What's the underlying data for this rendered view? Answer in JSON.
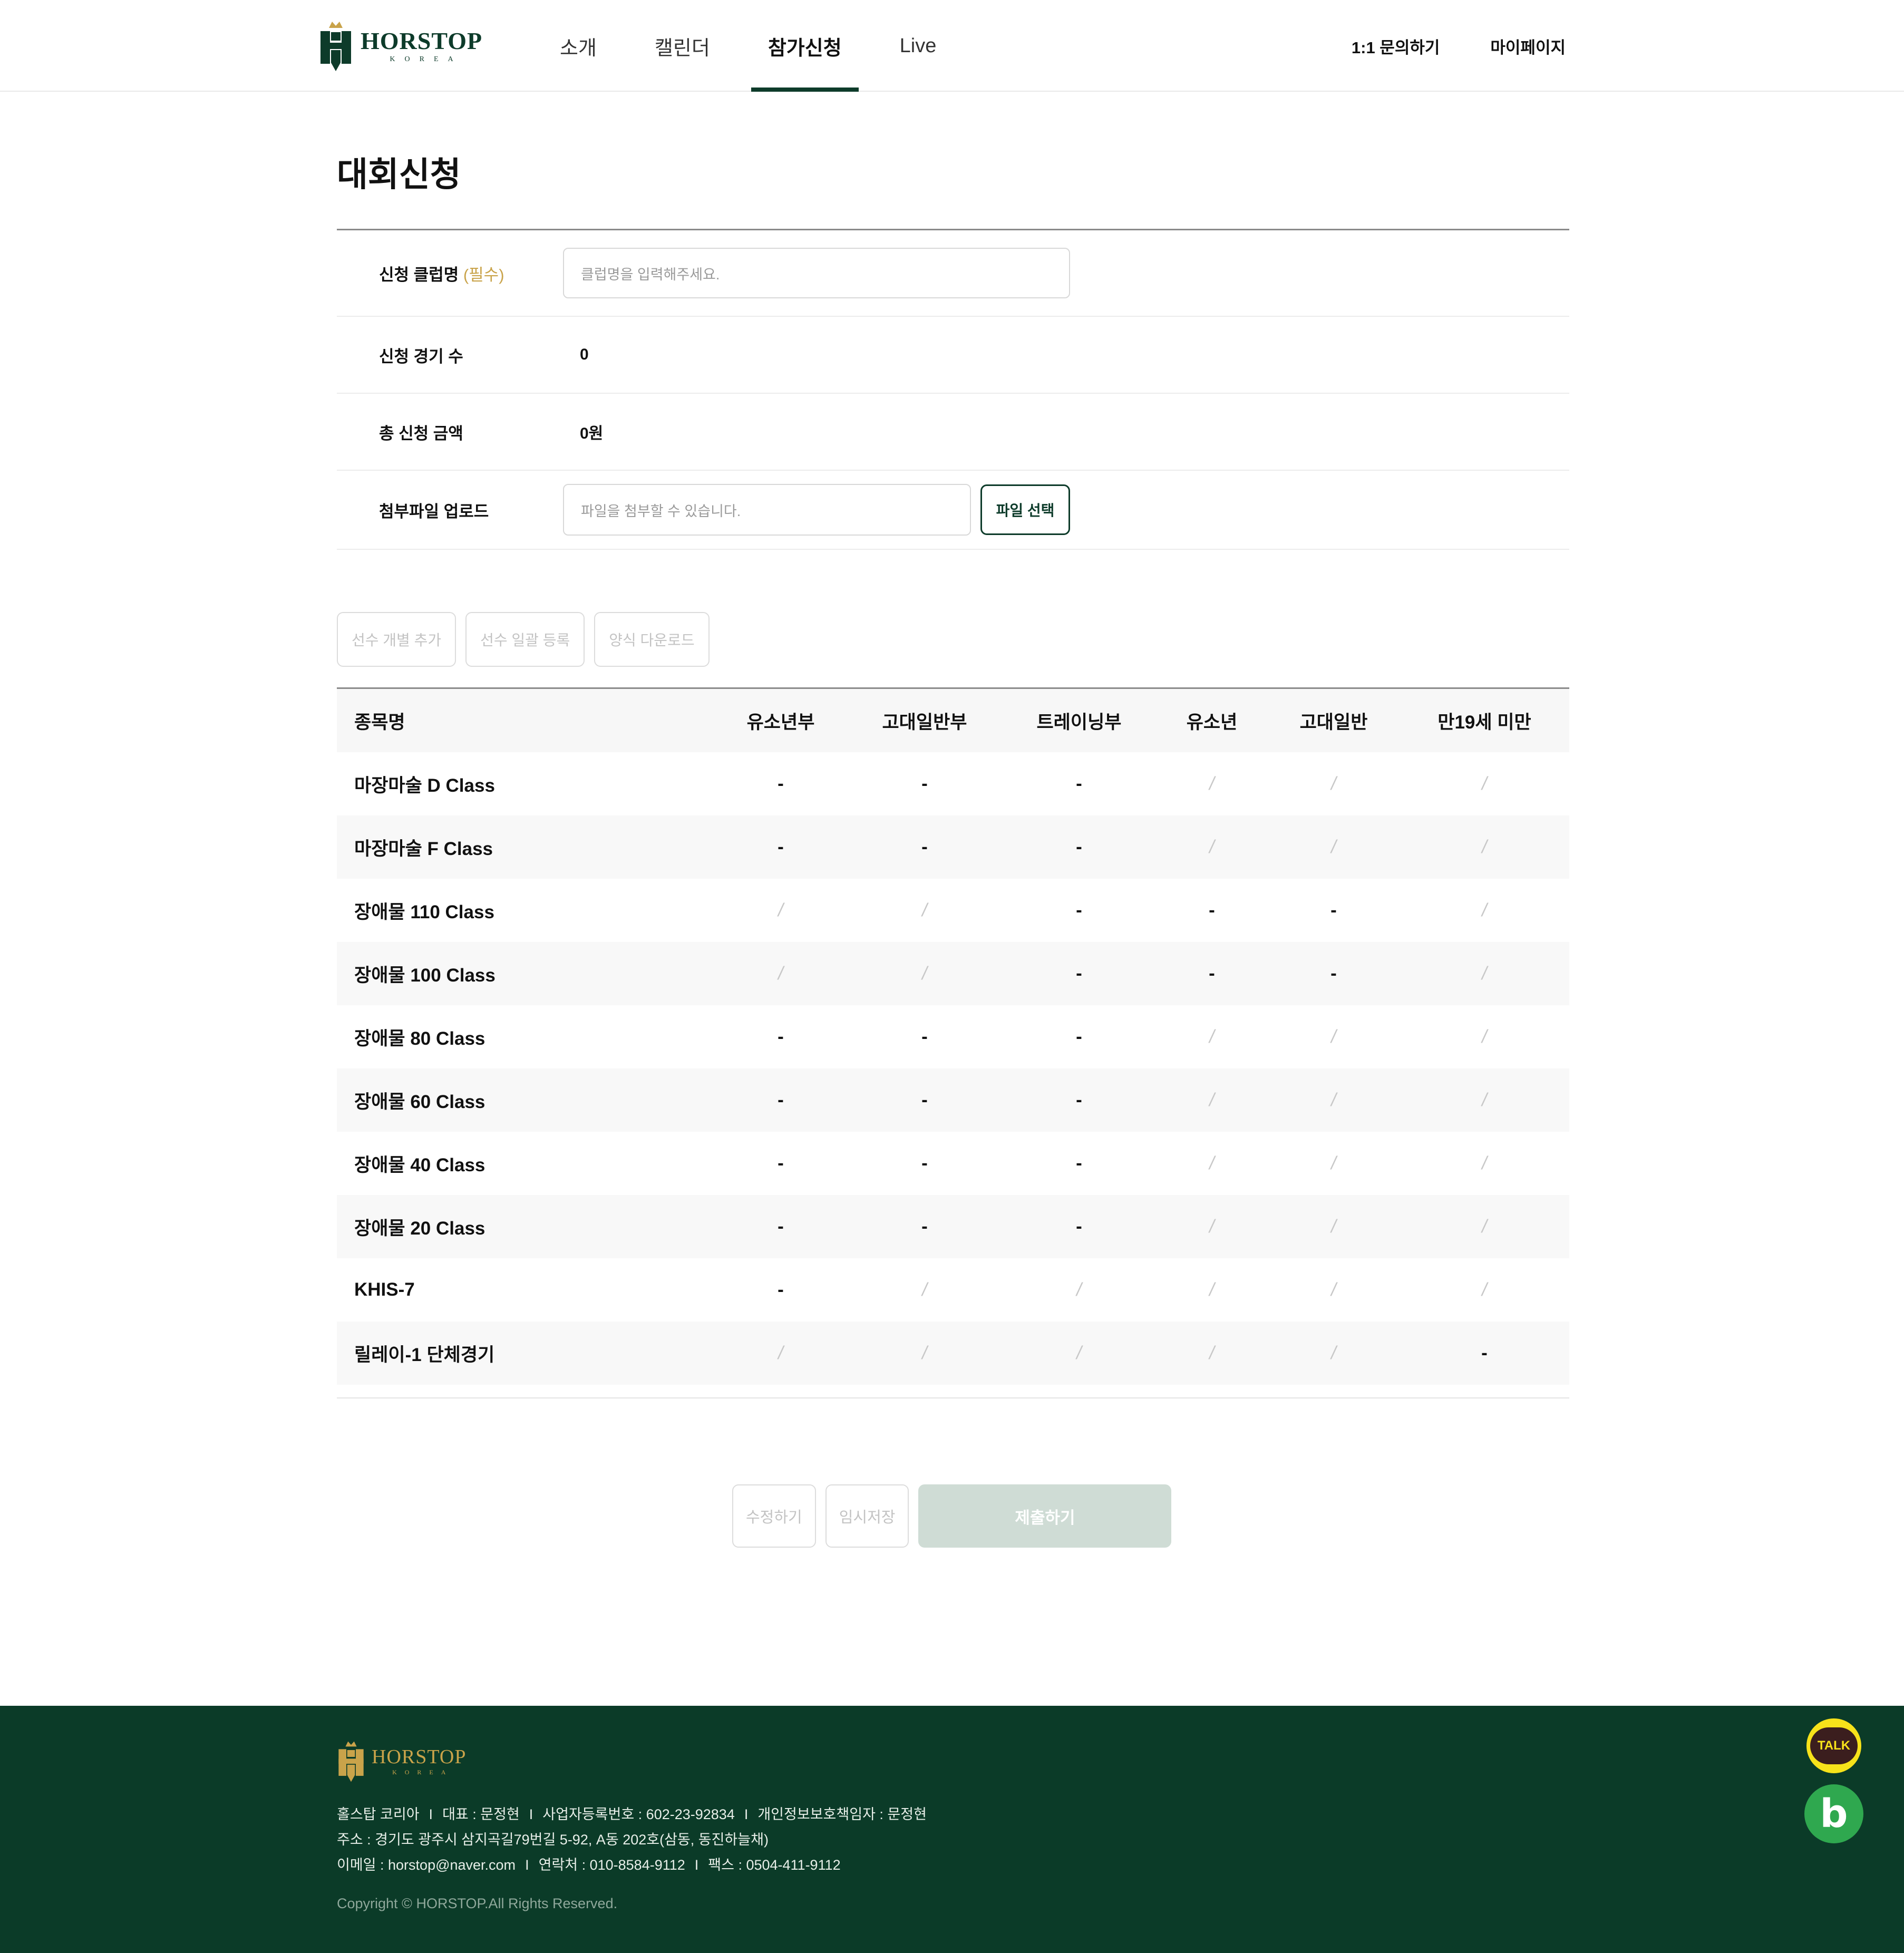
{
  "header": {
    "brand": "HORSTOP",
    "brand_sub": "KOREA",
    "nav": [
      {
        "label": "소개"
      },
      {
        "label": "캘린더"
      },
      {
        "label": "참가신청"
      },
      {
        "label": "Live"
      }
    ],
    "active_nav": "참가신청",
    "util": {
      "inquiry": "1:1 문의하기",
      "mypage": "마이페이지"
    }
  },
  "page_title": "대회신청",
  "form": {
    "club_label": "신청 클럽명",
    "club_required": "(필수)",
    "club_placeholder": "클럽명을 입력해주세요.",
    "count_label": "신청 경기 수",
    "count_value": "0",
    "amount_label": "총 신청 금액",
    "amount_value": "0원",
    "upload_label": "첨부파일 업로드",
    "upload_placeholder": "파일을 첨부할 수 있습니다.",
    "upload_button": "파일 선택"
  },
  "actions": {
    "add_individual": "선수 개별 추가",
    "bulk_register": "선수 일괄 등록",
    "download_form": "양식 다운로드"
  },
  "table": {
    "headers": [
      "종목명",
      "유소년부",
      "고대일반부",
      "트레이닝부",
      "유소년",
      "고대일반",
      "만19세 미만"
    ],
    "rows": [
      {
        "name": "마장마술 D Class",
        "cells": [
          "-",
          "-",
          "-",
          "/",
          "/",
          "/"
        ]
      },
      {
        "name": "마장마술 F Class",
        "cells": [
          "-",
          "-",
          "-",
          "/",
          "/",
          "/"
        ]
      },
      {
        "name": "장애물 110 Class",
        "cells": [
          "/",
          "/",
          "-",
          "-",
          "-",
          "/"
        ]
      },
      {
        "name": "장애물 100 Class",
        "cells": [
          "/",
          "/",
          "-",
          "-",
          "-",
          "/"
        ]
      },
      {
        "name": "장애물 80 Class",
        "cells": [
          "-",
          "-",
          "-",
          "/",
          "/",
          "/"
        ]
      },
      {
        "name": "장애물 60 Class",
        "cells": [
          "-",
          "-",
          "-",
          "/",
          "/",
          "/"
        ]
      },
      {
        "name": "장애물 40 Class",
        "cells": [
          "-",
          "-",
          "-",
          "/",
          "/",
          "/"
        ]
      },
      {
        "name": "장애물 20 Class",
        "cells": [
          "-",
          "-",
          "-",
          "/",
          "/",
          "/"
        ]
      },
      {
        "name": "KHIS-7",
        "cells": [
          "-",
          "/",
          "/",
          "/",
          "/",
          "/"
        ]
      },
      {
        "name": "릴레이-1 단체경기",
        "cells": [
          "/",
          "/",
          "/",
          "/",
          "/",
          "-"
        ]
      }
    ]
  },
  "bottom": {
    "edit": "수정하기",
    "temp_save": "임시저장",
    "submit": "제출하기"
  },
  "footer": {
    "brand": "HORSTOP",
    "brand_sub": "KOREA",
    "company": "홀스탑 코리아",
    "ceo": "대표 : 문정현",
    "biz_no": "사업자등록번호 : 602-23-92834",
    "privacy": "개인정보보호책임자 : 문정현",
    "address": "주소 : 경기도 광주시 삼지곡길79번길 5-92, A동 202호(삼동, 동진하늘채)",
    "email": "이메일 : horstop@naver.com",
    "phone": "연락처 : 010-8584-9112",
    "fax": "팩스 : 0504-411-9112",
    "separator": "I",
    "copyright": "Copyright © HORSTOP.All Rights Reserved.",
    "talk_label": "TALK",
    "blog_label": "b"
  },
  "colors": {
    "brand_green": "#0d3b2a",
    "footer_green": "#0b3b28",
    "gold": "#c9a34a",
    "submit_disabled": "#cfdcd5",
    "kakao_yellow": "#f7e21a",
    "blog_green": "#2fa84f"
  },
  "icons": [
    "horstop-logo-icon",
    "kakao-talk-icon",
    "blog-icon"
  ]
}
